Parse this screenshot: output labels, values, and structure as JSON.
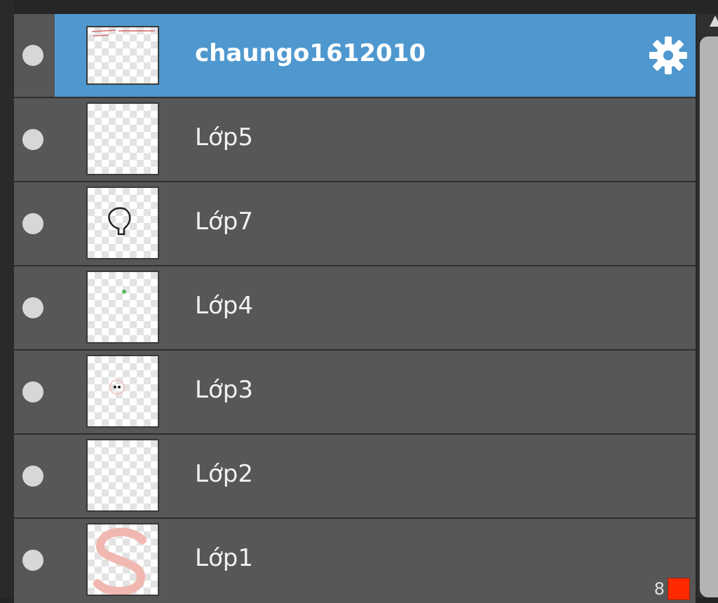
{
  "layers": [
    {
      "name": "chaungo1612010",
      "selected": true,
      "thumbnail": "text-sketch"
    },
    {
      "name": "Lớp5",
      "selected": false,
      "thumbnail": "empty"
    },
    {
      "name": "Lớp7",
      "selected": false,
      "thumbnail": "balloon-outline"
    },
    {
      "name": "Lớp4",
      "selected": false,
      "thumbnail": "green-dot"
    },
    {
      "name": "Lớp3",
      "selected": false,
      "thumbnail": "eyes"
    },
    {
      "name": "Lớp2",
      "selected": false,
      "thumbnail": "empty"
    },
    {
      "name": "Lớp1",
      "selected": false,
      "thumbnail": "s-stroke"
    }
  ],
  "footer": {
    "count": "8",
    "color": "#ff2a00"
  },
  "colors": {
    "selected_row": "#4f98cf",
    "row": "#575757",
    "background": "#262626"
  },
  "icons": {
    "visibility": "visibility-dot-icon",
    "settings": "gear-icon"
  }
}
